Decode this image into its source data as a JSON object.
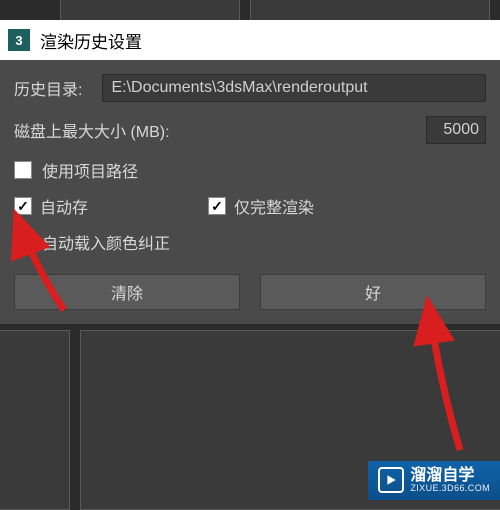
{
  "app_icon_text": "3",
  "window_title": "渲染历史设置",
  "labels": {
    "history_dir": "历史目录:",
    "disk_size": "磁盘上最大大小 (MB):"
  },
  "inputs": {
    "history_path": "E:\\Documents\\3dsMax\\renderoutput",
    "max_size": "5000"
  },
  "checkboxes": {
    "use_project_path": {
      "label": "使用项目路径",
      "checked": false
    },
    "auto_save": {
      "label": "自动存",
      "checked": true
    },
    "only_full_render": {
      "label": "仅完整渲染",
      "checked": true
    },
    "auto_load_cc": {
      "label": "自动载入颜色纠正",
      "checked": false
    }
  },
  "buttons": {
    "clear": "清除",
    "ok": "好"
  },
  "watermark": {
    "main": "溜溜自学",
    "sub": "ZIXUE.3D66.COM"
  },
  "check_mark": "✓"
}
